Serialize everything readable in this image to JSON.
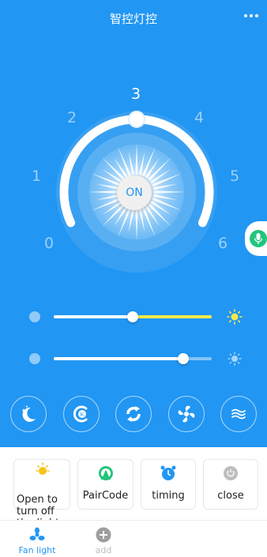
{
  "header": {
    "title": "智控灯控"
  },
  "dial": {
    "ticks": [
      "0",
      "1",
      "2",
      "3",
      "4",
      "5",
      "6"
    ],
    "active_tick": "3",
    "power_label": "ON"
  },
  "sliders": {
    "brightness": {
      "value": 0.5,
      "fill_color": "#f5e94a",
      "icon": "sun-bright-icon"
    },
    "color_temp": {
      "value": 0.82,
      "fill_color": "#ffffff",
      "icon": "sun-dim-icon"
    }
  },
  "modes": [
    {
      "icon": "night-mode-icon"
    },
    {
      "icon": "k-mode-icon"
    },
    {
      "icon": "cycle-mode-icon"
    },
    {
      "icon": "fan-mode-icon"
    },
    {
      "icon": "wave-mode-icon"
    }
  ],
  "actions": [
    {
      "label": "Open to turn off the lights",
      "icon": "sun-icon",
      "color": "#f5c518"
    },
    {
      "label": "PairCode",
      "icon": "pair-icon",
      "color": "#22c47c"
    },
    {
      "label": "timing",
      "icon": "alarm-clock-icon",
      "color": "#2196f3"
    },
    {
      "label": "close",
      "icon": "power-icon",
      "color": "#bdbdbd"
    }
  ],
  "tabs": [
    {
      "label": "Fan light",
      "icon": "fan-icon",
      "active": true
    },
    {
      "label": "add",
      "icon": "plus-circle-icon",
      "active": false
    }
  ],
  "colors": {
    "primary": "#2196f3",
    "accent_green": "#22c47c"
  }
}
